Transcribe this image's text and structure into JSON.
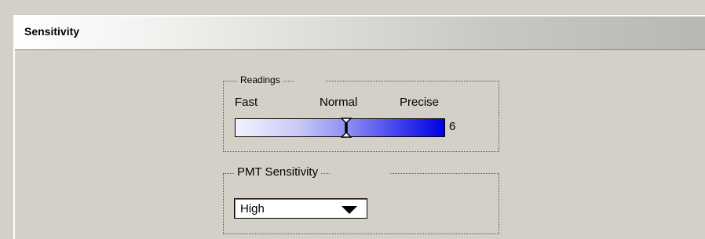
{
  "panel": {
    "title": "Sensitivity"
  },
  "readings": {
    "legend": "Readings",
    "labels": {
      "fast": "Fast",
      "normal": "Normal",
      "precise": "Precise"
    },
    "value": "6",
    "slider_fraction": 0.53
  },
  "pmt": {
    "legend": "PMT Sensitivity",
    "selected": "High"
  },
  "icons": {
    "slider_thumb": "i-beam-thumb-icon",
    "dropdown": "dropdown-arrow-icon"
  },
  "colors": {
    "bar_start": "#f2f2ff",
    "bar_end": "#0000e6",
    "background": "#d4d0c8"
  }
}
